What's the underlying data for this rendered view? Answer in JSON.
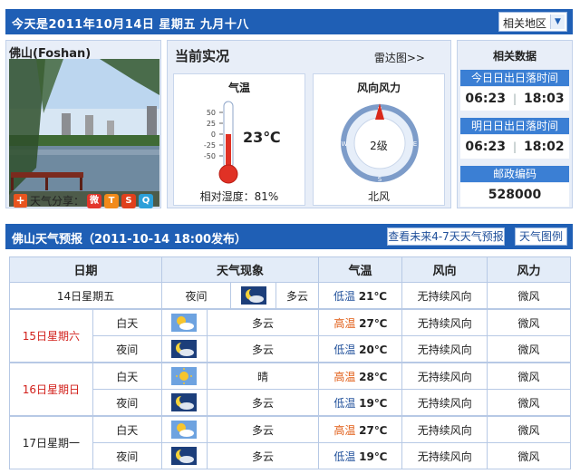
{
  "header": {
    "date_text": "今天是2011年10月14日  星期五  九月十八",
    "region_label": "相关地区"
  },
  "city_panel": {
    "city_name": "佛山(Foshan)",
    "share_label": "天气分享："
  },
  "current": {
    "title": "当前实况",
    "radar_link": "雷达图>>",
    "temp_box_title": "气温",
    "temperature": "23℃",
    "scale": [
      "50",
      "25",
      "0",
      "-25",
      "-50"
    ],
    "humidity": "相对湿度：81%",
    "wind_box_title": "风向风力",
    "wind_level": "2级",
    "wind_dir": "北风",
    "compass_n": "N",
    "compass_e": "E",
    "compass_s": "S",
    "compass_w": "W"
  },
  "related": {
    "title": "相关数据",
    "today_sun_hdr": "今日日出日落时间",
    "today_sunrise": "06:23",
    "today_sunset": "18:03",
    "tomorrow_sun_hdr": "明日日出日落时间",
    "tomorrow_sunrise": "06:23",
    "tomorrow_sunset": "18:02",
    "postcode_hdr": "邮政编码",
    "postcode": "528000"
  },
  "forecast": {
    "title": "佛山天气预报（2011-10-14  18:00发布）",
    "more_button": "查看未来4-7天天气预报",
    "legend_button": "天气图例",
    "columns": [
      "日期",
      "天气现象",
      "气温",
      "风向",
      "风力"
    ],
    "rows": [
      {
        "day": "14日星期五",
        "period": "夜间",
        "icon": "moon-cloud-icon",
        "weather": "多云",
        "temp_label": "低温",
        "temp": "21℃",
        "wind_dir": "无持续风向",
        "wind_power": "微风"
      },
      {
        "day": "15日星期六",
        "period": "白天",
        "icon": "sun-cloud-icon",
        "weather": "多云",
        "temp_label": "高温",
        "temp": "27℃",
        "wind_dir": "无持续风向",
        "wind_power": "微风"
      },
      {
        "day": "",
        "period": "夜间",
        "icon": "moon-cloud-icon",
        "weather": "多云",
        "temp_label": "低温",
        "temp": "20℃",
        "wind_dir": "无持续风向",
        "wind_power": "微风"
      },
      {
        "day": "16日星期日",
        "period": "白天",
        "icon": "sun-icon",
        "weather": "晴",
        "temp_label": "高温",
        "temp": "28℃",
        "wind_dir": "无持续风向",
        "wind_power": "微风"
      },
      {
        "day": "",
        "period": "夜间",
        "icon": "moon-cloud-icon",
        "weather": "多云",
        "temp_label": "低温",
        "temp": "19℃",
        "wind_dir": "无持续风向",
        "wind_power": "微风"
      },
      {
        "day": "17日星期一",
        "period": "白天",
        "icon": "sun-cloud-icon",
        "weather": "多云",
        "temp_label": "高温",
        "temp": "27℃",
        "wind_dir": "无持续风向",
        "wind_power": "微风"
      },
      {
        "day": "",
        "period": "夜间",
        "icon": "moon-cloud-icon",
        "weather": "多云",
        "temp_label": "低温",
        "temp": "19℃",
        "wind_dir": "无持续风向",
        "wind_power": "微风"
      }
    ]
  },
  "colors": {
    "header_blue": "#1f5fb5",
    "weekend_red": "#d2201b",
    "high_orange": "#e05a12",
    "low_blue": "#1f4f9a"
  }
}
